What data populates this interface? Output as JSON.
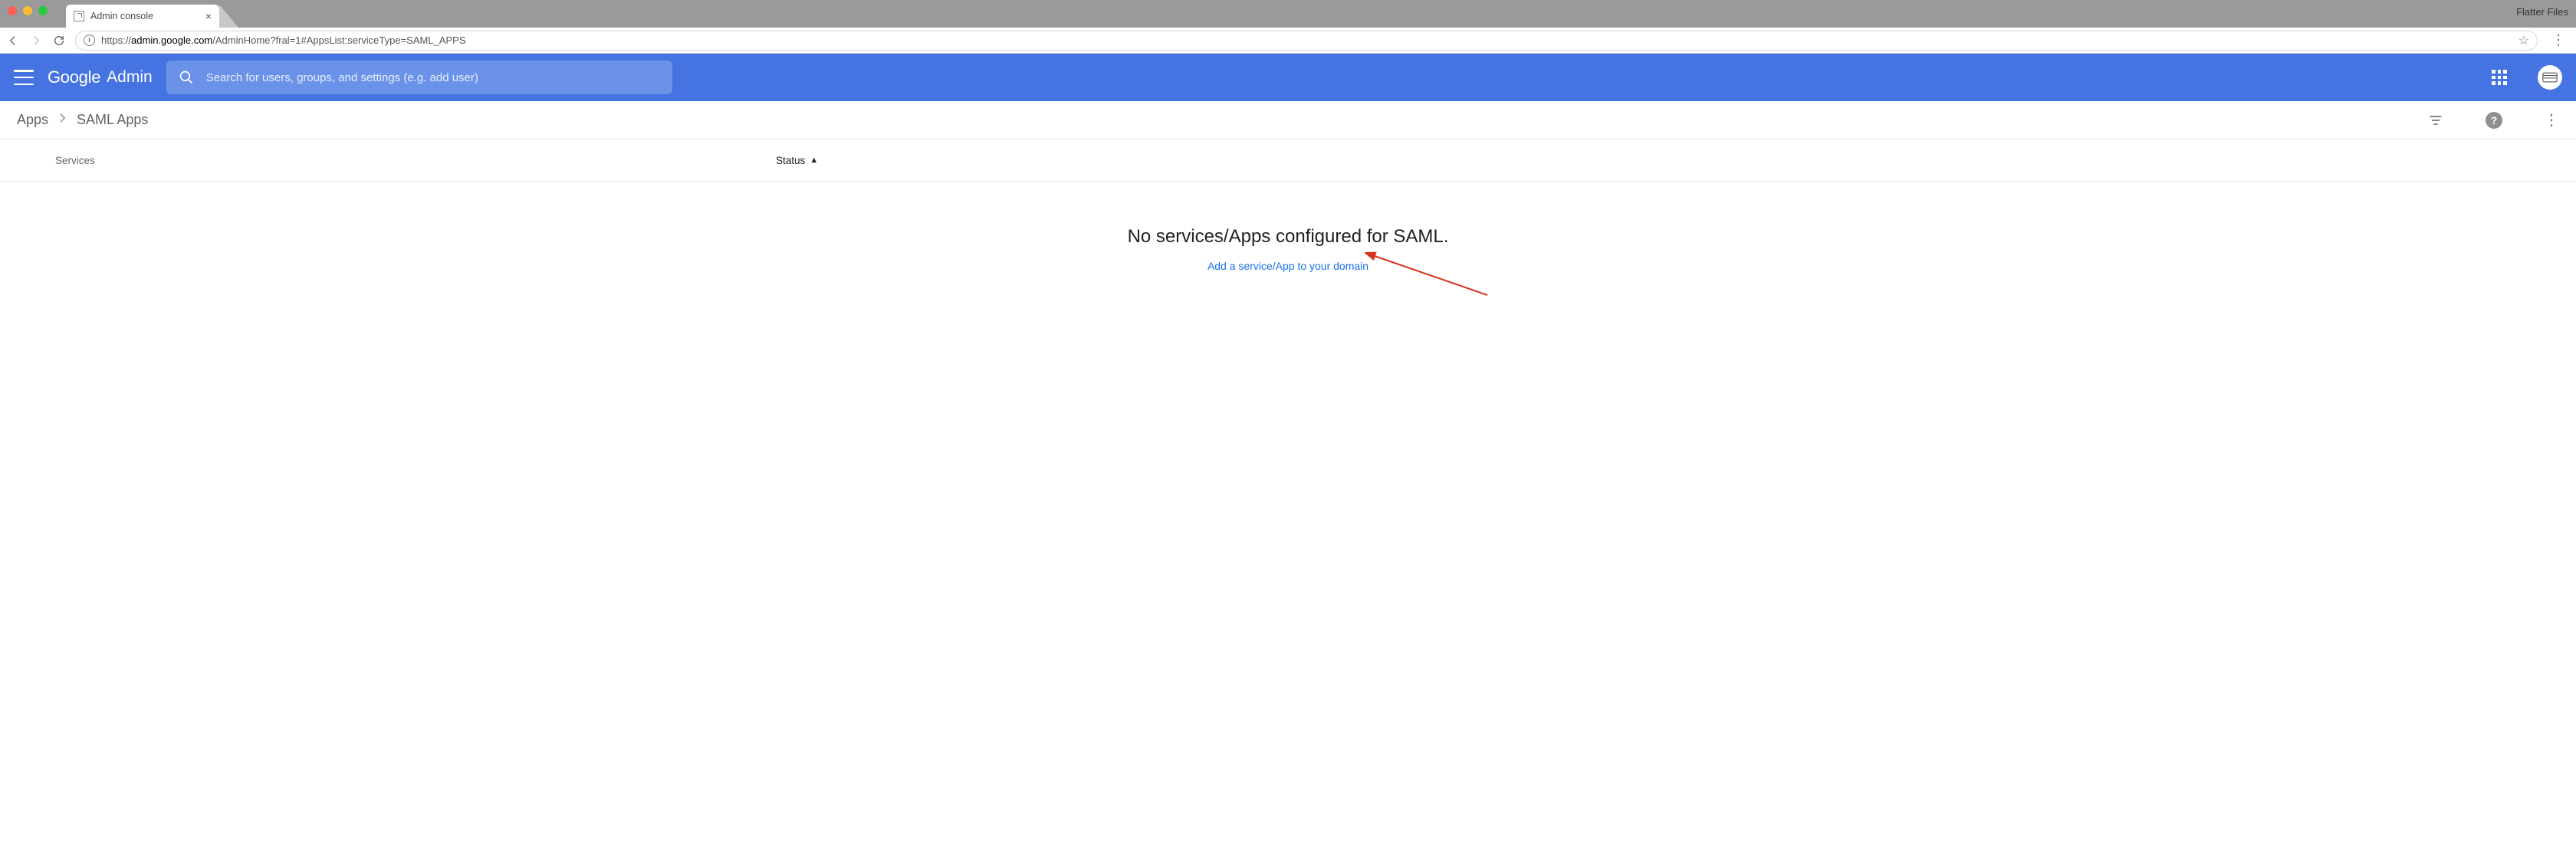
{
  "browser": {
    "window_label": "Flatter Files",
    "tab_title": "Admin console",
    "url_prefix": "https://",
    "url_host": "admin.google.com",
    "url_path": "/AdminHome?fral=1#AppsList:serviceType=SAML_APPS"
  },
  "header": {
    "logo_google": "Google",
    "logo_admin": "Admin",
    "search_placeholder": "Search for users, groups, and settings (e.g. add user)"
  },
  "breadcrumb": {
    "root": "Apps",
    "current": "SAML Apps"
  },
  "table": {
    "col_services": "Services",
    "col_status": "Status"
  },
  "empty_state": {
    "heading": "No services/Apps configured for SAML.",
    "link": "Add a service/App to your domain"
  }
}
